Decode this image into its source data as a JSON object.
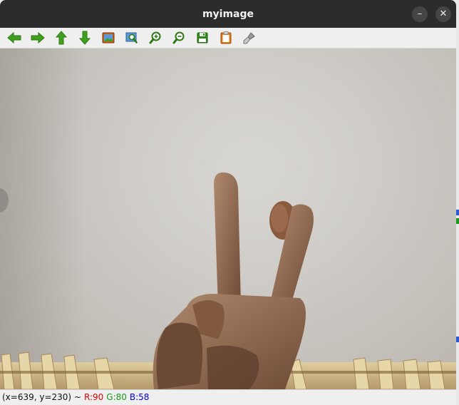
{
  "window": {
    "title": "myimage",
    "minimize_glyph": "–",
    "close_glyph": "✕"
  },
  "toolbar": {
    "buttons": [
      {
        "name": "pan-left",
        "icon": "arrow-left-icon"
      },
      {
        "name": "pan-right",
        "icon": "arrow-right-icon"
      },
      {
        "name": "pan-up",
        "icon": "arrow-up-icon"
      },
      {
        "name": "pan-down",
        "icon": "arrow-down-icon"
      },
      {
        "name": "zoom-fit",
        "icon": "image-icon"
      },
      {
        "name": "zoom-area",
        "icon": "zoom-area-icon"
      },
      {
        "name": "zoom-in",
        "icon": "zoom-in-icon"
      },
      {
        "name": "zoom-out",
        "icon": "zoom-out-icon"
      },
      {
        "name": "save",
        "icon": "floppy-icon"
      },
      {
        "name": "copy",
        "icon": "clipboard-icon"
      },
      {
        "name": "properties",
        "icon": "brush-icon"
      }
    ]
  },
  "image": {
    "description_icon": "camera-frame-image"
  },
  "status": {
    "coords": "(x=639, y=230) ~",
    "r": "R:90",
    "g": "G:80",
    "b": "B:58"
  },
  "colors": {
    "titlebar": "#2c2c2c",
    "arrow_green": "#3f9f1f",
    "r_color": "#e00000",
    "g_color": "#1a9a1a",
    "b_color": "#0000e0"
  }
}
